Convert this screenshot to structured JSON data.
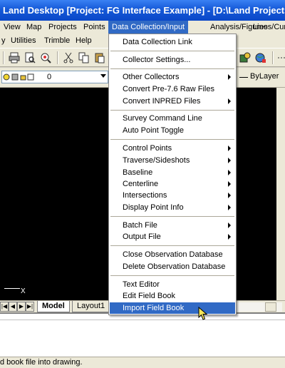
{
  "window": {
    "title": "Land Desktop [Project: FG Interface Example] - [D:\\Land Projects..."
  },
  "menubar": {
    "items": [
      "View",
      "Map",
      "Projects",
      "Points",
      "Data Collection/Input",
      "Analysis/Figures",
      "Lines/Cur"
    ],
    "active": "Data Collection/Input"
  },
  "menubar2": {
    "items": [
      "y",
      "Utilities",
      "Trimble",
      "Help"
    ]
  },
  "layerbar": {
    "layer_value": "0",
    "linetype": "ByLayer"
  },
  "drawing": {
    "ucs_axis": "X"
  },
  "tabs": {
    "nav": [
      "|◀",
      "◀",
      "▶",
      "▶|"
    ],
    "model": "Model",
    "layout": "Layout1"
  },
  "status": {
    "text": "d book file into drawing."
  },
  "dropdown": {
    "items": [
      {
        "label": "Data Collection Link",
        "submenu": false
      },
      {
        "label": "Collector Settings...",
        "submenu": false
      },
      {
        "label": "Other Collectors",
        "submenu": true
      },
      {
        "label": "Convert Pre-7.6 Raw Files",
        "submenu": false
      },
      {
        "label": "Convert INPRED Files",
        "submenu": true
      },
      {
        "label": "Survey Command Line",
        "submenu": false
      },
      {
        "label": "Auto Point Toggle",
        "submenu": false
      },
      {
        "label": "Control Points",
        "submenu": true
      },
      {
        "label": "Traverse/Sideshots",
        "submenu": true
      },
      {
        "label": "Baseline",
        "submenu": true
      },
      {
        "label": "Centerline",
        "submenu": true
      },
      {
        "label": "Intersections",
        "submenu": true
      },
      {
        "label": "Display Point Info",
        "submenu": true
      },
      {
        "label": "Batch File",
        "submenu": true
      },
      {
        "label": "Output File",
        "submenu": true
      },
      {
        "label": "Close Observation Database",
        "submenu": false
      },
      {
        "label": "Delete Observation Database",
        "submenu": false
      },
      {
        "label": "Text Editor",
        "submenu": false
      },
      {
        "label": "Edit Field Book",
        "submenu": false
      },
      {
        "label": "Import Field Book",
        "submenu": false
      }
    ],
    "highlighted": "Import Field Book"
  },
  "colors": {
    "title_blue": "#0a47c8",
    "highlight": "#316ac5",
    "canvas": "#000000"
  }
}
